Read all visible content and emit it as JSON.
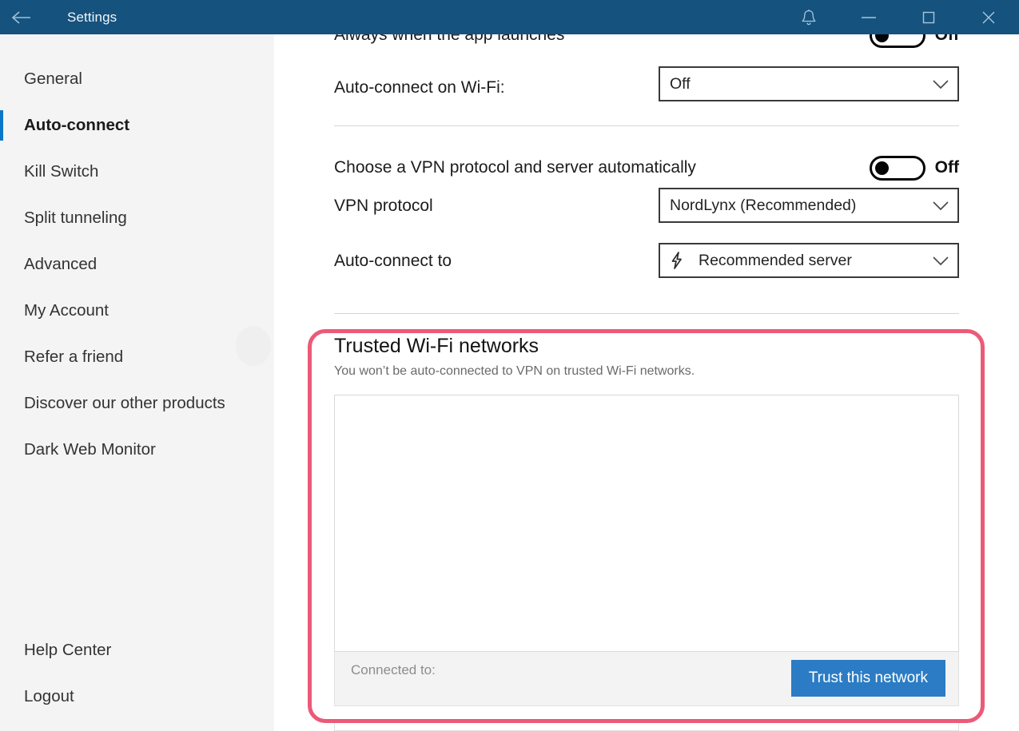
{
  "titlebar": {
    "back_icon": "arrow-left-icon",
    "title": "Settings",
    "bell_icon": "bell-icon",
    "minimize_icon": "minimize-icon",
    "maximize_icon": "maximize-icon",
    "close_icon": "close-icon",
    "background_color": "#15527e"
  },
  "sidebar": {
    "background_color": "#f4f4f4",
    "accent_color": "#0a76c8",
    "items": [
      {
        "label": "General",
        "active": false
      },
      {
        "label": "Auto-connect",
        "active": true
      },
      {
        "label": "Kill Switch",
        "active": false
      },
      {
        "label": "Split tunneling",
        "active": false
      },
      {
        "label": "Advanced",
        "active": false
      },
      {
        "label": "My Account",
        "active": false
      },
      {
        "label": "Refer a friend",
        "active": false
      },
      {
        "label": "Discover our other products",
        "active": false
      },
      {
        "label": "Dark Web Monitor",
        "active": false
      }
    ],
    "bottom_items": [
      {
        "label": "Help Center"
      },
      {
        "label": "Logout"
      }
    ]
  },
  "main": {
    "always_launch": {
      "label": "Always when the app launches",
      "toggle_state": "Off",
      "toggle_on": false
    },
    "autoconnect_wifi": {
      "label": "Auto-connect on Wi-Fi:",
      "value": "Off"
    },
    "auto_protocol": {
      "label": "Choose a VPN protocol and server automatically",
      "toggle_state": "Off",
      "toggle_on": false
    },
    "vpn_protocol": {
      "label": "VPN protocol",
      "value": "NordLynx (Recommended)"
    },
    "autoconnect_to": {
      "label": "Auto-connect to",
      "value": "Recommended server",
      "icon": "lightning-bolt-icon"
    },
    "trusted_wifi": {
      "title": "Trusted Wi-Fi networks",
      "subtitle": "You won’t be auto-connected to VPN on trusted Wi-Fi networks.",
      "network_list": [],
      "connected_label": "Connected to:",
      "connected_value": "",
      "trust_button": "Trust this network",
      "trust_button_color": "#2b7cc4",
      "highlight_color": "#eb5a78"
    }
  }
}
